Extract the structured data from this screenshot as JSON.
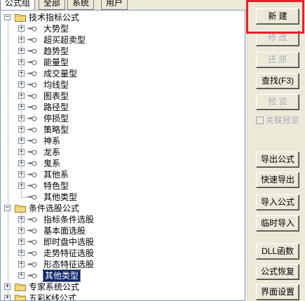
{
  "tabs": [
    {
      "label": "公式组"
    },
    {
      "label": "全部"
    },
    {
      "label": "系统"
    },
    {
      "label": "用户"
    }
  ],
  "tree": {
    "group1": {
      "label": "技术指标公式",
      "items": [
        "大势型",
        "超买超卖型",
        "趋势型",
        "能量型",
        "成交量型",
        "均线型",
        "图表型",
        "路径型",
        "停损型",
        "策略型",
        "神系",
        "龙系",
        "鬼系",
        "其他系",
        "特色型",
        "其他类型"
      ]
    },
    "group2": {
      "label": "条件选股公式",
      "items": [
        "指标条件选股",
        "基本面选股",
        "即时盘中选股",
        "走势特征选股",
        "形态特征选股",
        "其他类型"
      ]
    },
    "group3": {
      "label": "专家系统公式"
    },
    "group4": {
      "label": "五彩K线公式"
    }
  },
  "buttons": {
    "new": "新 建",
    "modify": "修 改",
    "restore": "还 原",
    "find": "查找(F3)",
    "preview": "预 览",
    "linked_preview": "关联预览",
    "export": "导出公式",
    "quick_export": "快速导出",
    "import": "导入公式",
    "temp_import": "临时导入",
    "dll": "DLL函数",
    "recover": "公式恢复",
    "ui_settings": "界面设置"
  },
  "colors": {
    "highlight_box": "#e8202a",
    "selection": "#0a246a"
  }
}
